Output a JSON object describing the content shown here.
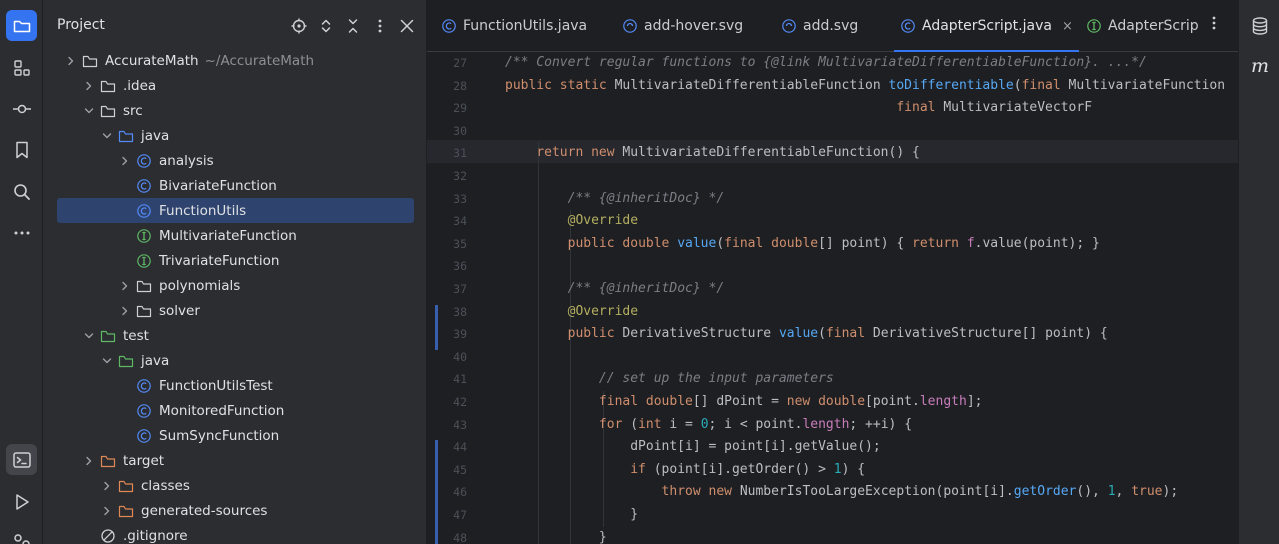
{
  "colors": {
    "accent": "#3574f0",
    "selection": "#2e436e",
    "keyword": "#cf8e6d",
    "comment": "#7a7e85",
    "function": "#56a8f5",
    "annotation": "#b3ae60",
    "number": "#2aacb8",
    "field": "#c77dbb"
  },
  "left_toolbar": {
    "items": [
      {
        "icon": "folder-icon",
        "active": true
      },
      {
        "icon": "structure-icon"
      },
      {
        "icon": "commit-icon"
      },
      {
        "icon": "bookmark-icon"
      },
      {
        "icon": "search-icon"
      },
      {
        "icon": "more-icon"
      },
      {
        "icon": "terminal-icon",
        "pressed": true
      },
      {
        "icon": "run-icon"
      },
      {
        "icon": "services-icon"
      }
    ]
  },
  "project": {
    "title": "Project",
    "actions": [
      "target-icon",
      "expand-collapse-icon",
      "collapse-all-icon",
      "kebab-icon",
      "close-icon"
    ],
    "tree": [
      {
        "label": "AccurateMath",
        "path": "~/AccurateMath",
        "type": "folder",
        "expanded": false
      },
      {
        "label": ".idea",
        "type": "folder",
        "expanded": false
      },
      {
        "label": "src",
        "type": "folder",
        "expanded": true
      },
      {
        "label": "java",
        "type": "source-folder",
        "expanded": true
      },
      {
        "label": "analysis",
        "type": "package",
        "expanded": false
      },
      {
        "label": "BivariateFunction",
        "type": "class"
      },
      {
        "label": "FunctionUtils",
        "type": "class",
        "selected": true
      },
      {
        "label": "MultivariateFunction",
        "type": "interface"
      },
      {
        "label": "TrivariateFunction",
        "type": "interface"
      },
      {
        "label": "polynomials",
        "type": "folder",
        "expanded": false
      },
      {
        "label": "solver",
        "type": "folder",
        "expanded": false
      },
      {
        "label": "test",
        "type": "test-folder",
        "expanded": true
      },
      {
        "label": "java",
        "type": "test-source-folder",
        "expanded": true
      },
      {
        "label": "FunctionUtilsTest",
        "type": "class"
      },
      {
        "label": "MonitoredFunction",
        "type": "class"
      },
      {
        "label": "SumSyncFunction",
        "type": "class"
      },
      {
        "label": "target",
        "type": "excluded-folder",
        "expanded": false
      },
      {
        "label": "classes",
        "type": "excluded-folder",
        "expanded": false
      },
      {
        "label": "generated-sources",
        "type": "excluded-folder",
        "expanded": false
      },
      {
        "label": ".gitignore",
        "type": "ignore-file"
      }
    ]
  },
  "tabs": [
    {
      "label": "FunctionUtils.java",
      "icon": "class-icon"
    },
    {
      "label": "add-hover.svg",
      "icon": "svg-file-icon"
    },
    {
      "label": "add.svg",
      "icon": "svg-file-icon"
    },
    {
      "label": "AdapterScript.java",
      "icon": "class-icon",
      "active": true,
      "close": "×"
    },
    {
      "label": "AdapterScrip",
      "icon": "interface-icon"
    }
  ],
  "editor": {
    "line_numbers": [
      "27",
      "28",
      "29",
      "30",
      "31",
      "32",
      "33",
      "34",
      "35",
      "36",
      "37",
      "38",
      "39",
      "40",
      "41",
      "42",
      "43",
      "44",
      "45",
      "46",
      "47",
      "48"
    ],
    "lines": [
      [
        {
          "t": "/** Convert regular functions to {",
          "c": "cm"
        },
        {
          "t": "@link",
          "c": "cm"
        },
        {
          "t": " MultivariateDifferentiableFunction}. ...*/",
          "c": "cm"
        }
      ],
      [
        {
          "t": "public static ",
          "c": "kw"
        },
        {
          "t": "MultivariateDifferentiableFunction ",
          "c": "pl"
        },
        {
          "t": "toDifferentiable",
          "c": "fn"
        },
        {
          "t": "(",
          "c": "pl"
        },
        {
          "t": "final ",
          "c": "kw"
        },
        {
          "t": "MultivariateFunction",
          "c": "pl"
        }
      ],
      [
        {
          "t": "                                                  ",
          "c": "pl"
        },
        {
          "t": "final ",
          "c": "kw"
        },
        {
          "t": "MultivariateVectorF",
          "c": "pl"
        }
      ],
      [],
      [
        {
          "t": "    ",
          "c": "pl"
        },
        {
          "t": "return new ",
          "c": "kw"
        },
        {
          "t": "MultivariateDifferentiableFunction() {",
          "c": "pl"
        }
      ],
      [],
      [
        {
          "t": "        /** {",
          "c": "cm"
        },
        {
          "t": "@inheritDoc",
          "c": "cm"
        },
        {
          "t": "} */",
          "c": "cm"
        }
      ],
      [
        {
          "t": "        ",
          "c": "pl"
        },
        {
          "t": "@Override",
          "c": "an"
        }
      ],
      [
        {
          "t": "        ",
          "c": "pl"
        },
        {
          "t": "public double ",
          "c": "kw"
        },
        {
          "t": "value",
          "c": "fn"
        },
        {
          "t": "(",
          "c": "pl"
        },
        {
          "t": "final double",
          "c": "kw"
        },
        {
          "t": "[] point) { ",
          "c": "pl"
        },
        {
          "t": "return ",
          "c": "kw"
        },
        {
          "t": "f",
          "c": "fld"
        },
        {
          "t": ".value(point); }",
          "c": "pl"
        }
      ],
      [],
      [
        {
          "t": "        /** {",
          "c": "cm"
        },
        {
          "t": "@inheritDoc",
          "c": "cm"
        },
        {
          "t": "} */",
          "c": "cm"
        }
      ],
      [
        {
          "t": "        ",
          "c": "pl"
        },
        {
          "t": "@Override",
          "c": "an"
        }
      ],
      [
        {
          "t": "        ",
          "c": "pl"
        },
        {
          "t": "public ",
          "c": "kw"
        },
        {
          "t": "DerivativeStructure ",
          "c": "pl"
        },
        {
          "t": "value",
          "c": "fn"
        },
        {
          "t": "(",
          "c": "pl"
        },
        {
          "t": "final ",
          "c": "kw"
        },
        {
          "t": "DerivativeStructure[] point) {",
          "c": "pl"
        }
      ],
      [],
      [
        {
          "t": "            // set up the input parameters",
          "c": "cm"
        }
      ],
      [
        {
          "t": "            ",
          "c": "pl"
        },
        {
          "t": "final double",
          "c": "kw"
        },
        {
          "t": "[] dPoint = ",
          "c": "pl"
        },
        {
          "t": "new double",
          "c": "kw"
        },
        {
          "t": "[point.",
          "c": "pl"
        },
        {
          "t": "length",
          "c": "fld"
        },
        {
          "t": "];",
          "c": "pl"
        }
      ],
      [
        {
          "t": "            ",
          "c": "pl"
        },
        {
          "t": "for ",
          "c": "kw"
        },
        {
          "t": "(",
          "c": "pl"
        },
        {
          "t": "int ",
          "c": "kw"
        },
        {
          "t": "i = ",
          "c": "pl"
        },
        {
          "t": "0",
          "c": "num"
        },
        {
          "t": "; i < point.",
          "c": "pl"
        },
        {
          "t": "length",
          "c": "fld"
        },
        {
          "t": "; ++i) {",
          "c": "pl"
        }
      ],
      [
        {
          "t": "                dPoint[i] = point[i].getValue();",
          "c": "pl"
        }
      ],
      [
        {
          "t": "                ",
          "c": "pl"
        },
        {
          "t": "if ",
          "c": "kw"
        },
        {
          "t": "(point[i].getOrder() > ",
          "c": "pl"
        },
        {
          "t": "1",
          "c": "num"
        },
        {
          "t": ") {",
          "c": "pl"
        }
      ],
      [
        {
          "t": "                    ",
          "c": "pl"
        },
        {
          "t": "throw new ",
          "c": "kw"
        },
        {
          "t": "NumberIsTooLargeException(point[i].",
          "c": "pl"
        },
        {
          "t": "getOrder",
          "c": "fn"
        },
        {
          "t": "(), ",
          "c": "pl"
        },
        {
          "t": "1",
          "c": "num"
        },
        {
          "t": ", ",
          "c": "pl"
        },
        {
          "t": "true",
          "c": "kw"
        },
        {
          "t": ");",
          "c": "pl"
        }
      ],
      [
        {
          "t": "                }",
          "c": "pl"
        }
      ],
      [
        {
          "t": "            }",
          "c": "pl"
        }
      ]
    ]
  },
  "right_toolbar": {
    "items": [
      {
        "icon": "database-icon"
      },
      {
        "icon": "maven-icon",
        "label": "m"
      }
    ]
  }
}
